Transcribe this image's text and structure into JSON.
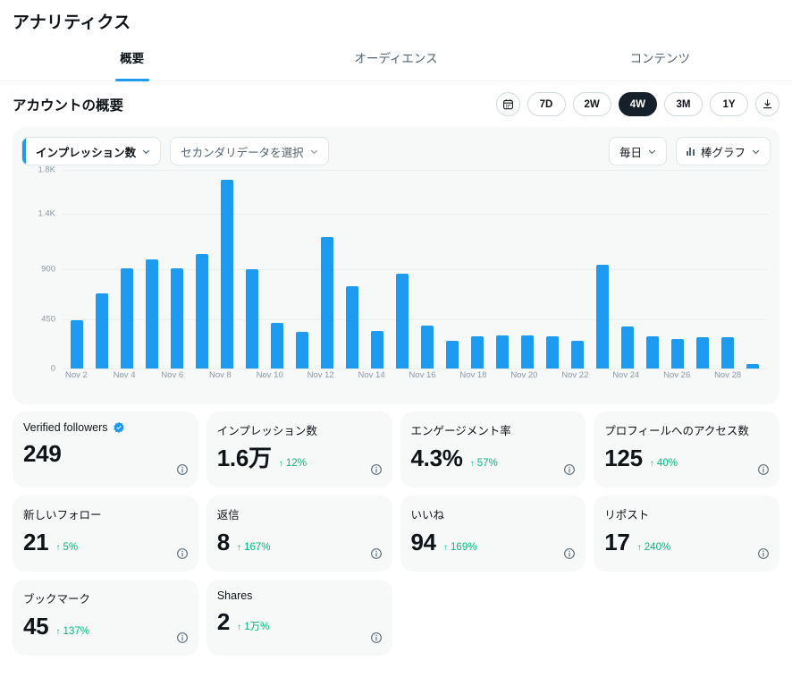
{
  "header": {
    "title": "アナリティクス",
    "tabs": [
      {
        "label": "概要",
        "active": true
      },
      {
        "label": "オーディエンス",
        "active": false
      },
      {
        "label": "コンテンツ",
        "active": false
      }
    ]
  },
  "account_section": {
    "title": "アカウントの概要",
    "calendar_icon": "calendar-icon",
    "download_icon": "download-icon",
    "ranges": [
      {
        "label": "7D",
        "active": false
      },
      {
        "label": "2W",
        "active": false
      },
      {
        "label": "4W",
        "active": true
      },
      {
        "label": "3M",
        "active": false
      },
      {
        "label": "1Y",
        "active": false
      }
    ]
  },
  "chart_controls": {
    "primary_metric": "インプレッション数",
    "secondary_metric": "セカンダリデータを選択",
    "granularity": "毎日",
    "chart_type": "棒グラフ",
    "chart_type_icon": "bar-chart-icon",
    "chevron_icon": "chevron-down-icon",
    "accent_color": "#1d9bf0"
  },
  "chart_data": {
    "type": "bar",
    "title": "インプレッション数",
    "xlabel": "",
    "ylabel": "",
    "ylim": [
      0,
      1800
    ],
    "grid": true,
    "legend": false,
    "bar_color": "#1d9bf0",
    "ytick_labels": [
      "0",
      "450",
      "900",
      "1.4K",
      "1.8K"
    ],
    "ytick_values": [
      0,
      450,
      900,
      1400,
      1800
    ],
    "xtick_labels": [
      "Nov 2",
      "Nov 4",
      "Nov 6",
      "Nov 8",
      "Nov 10",
      "Nov 12",
      "Nov 14",
      "Nov 16",
      "Nov 18",
      "Nov 20",
      "Nov 22",
      "Nov 24",
      "Nov 26",
      "Nov 28"
    ],
    "categories": [
      "Nov 2",
      "Nov 3",
      "Nov 4",
      "Nov 5",
      "Nov 6",
      "Nov 7",
      "Nov 8",
      "Nov 9",
      "Nov 10",
      "Nov 11",
      "Nov 12",
      "Nov 13",
      "Nov 14",
      "Nov 15",
      "Nov 16",
      "Nov 17",
      "Nov 18",
      "Nov 19",
      "Nov 20",
      "Nov 21",
      "Nov 22",
      "Nov 23",
      "Nov 24",
      "Nov 25",
      "Nov 26",
      "Nov 27",
      "Nov 28",
      "Nov 29"
    ],
    "values": [
      440,
      680,
      910,
      990,
      910,
      1040,
      1710,
      900,
      410,
      330,
      1190,
      745,
      340,
      860,
      390,
      250,
      290,
      300,
      300,
      290,
      250,
      940,
      380,
      290,
      270,
      280,
      280,
      40
    ]
  },
  "metric_cards": [
    {
      "label": "Verified followers",
      "value": "249",
      "delta": "",
      "verified": true,
      "info_icon": "info-icon"
    },
    {
      "label": "インプレッション数",
      "value": "1.6万",
      "delta": "12%",
      "verified": false,
      "info_icon": "info-icon"
    },
    {
      "label": "エンゲージメント率",
      "value": "4.3%",
      "delta": "57%",
      "verified": false,
      "info_icon": "info-icon"
    },
    {
      "label": "プロフィールへのアクセス数",
      "value": "125",
      "delta": "40%",
      "verified": false,
      "info_icon": "info-icon"
    },
    {
      "label": "新しいフォロー",
      "value": "21",
      "delta": "5%",
      "verified": false,
      "info_icon": "info-icon"
    },
    {
      "label": "返信",
      "value": "8",
      "delta": "167%",
      "verified": false,
      "info_icon": "info-icon"
    },
    {
      "label": "いいね",
      "value": "94",
      "delta": "169%",
      "verified": false,
      "info_icon": "info-icon"
    },
    {
      "label": "リポスト",
      "value": "17",
      "delta": "240%",
      "verified": false,
      "info_icon": "info-icon"
    },
    {
      "label": "ブックマーク",
      "value": "45",
      "delta": "137%",
      "verified": false,
      "info_icon": "info-icon"
    },
    {
      "label": "Shares",
      "value": "2",
      "delta": "1万%",
      "verified": false,
      "info_icon": "info-icon"
    }
  ],
  "colors": {
    "accent": "#1d9bf0",
    "positive": "#00ba7c",
    "panel": "#f7f9f9",
    "text": "#0f1419",
    "muted": "#536471",
    "active_pill": "#16202a"
  }
}
